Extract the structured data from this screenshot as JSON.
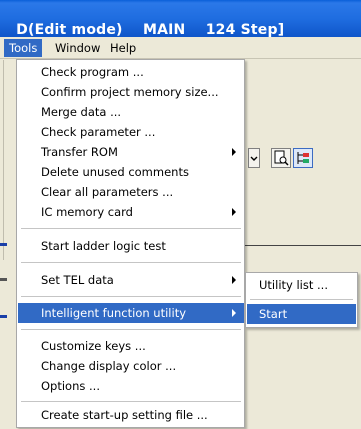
{
  "title": "D(Edit mode)    MAIN    124 Step]",
  "menubar": {
    "tools": "Tools",
    "window": "Window",
    "help": "Help"
  },
  "tools_menu": {
    "items": [
      {
        "label": "Check program ..."
      },
      {
        "label": "Confirm project memory size..."
      },
      {
        "label": "Merge data ..."
      },
      {
        "label": "Check parameter ..."
      },
      {
        "label": "Transfer ROM",
        "submenu": true
      },
      {
        "label": "Delete unused comments"
      },
      {
        "label": "Clear all parameters ..."
      },
      {
        "label": "IC memory card",
        "submenu": true
      },
      {
        "label": "Start ladder logic test"
      },
      {
        "label": "Set TEL data",
        "submenu": true
      },
      {
        "label": "Intelligent function utility",
        "submenu": true,
        "highlighted": true
      },
      {
        "label": "Customize keys ..."
      },
      {
        "label": "Change display color ..."
      },
      {
        "label": "Options ..."
      },
      {
        "label": "Create start-up setting file ..."
      }
    ]
  },
  "utility_submenu": {
    "items": [
      {
        "label": "Utility list ..."
      },
      {
        "label": "Start",
        "highlighted": true
      }
    ]
  },
  "colors": {
    "titlebar": "#1f6de0",
    "highlight": "#316ac5",
    "menu_bg": "#ece9d8"
  },
  "icons": [
    "submenu-arrow-icon",
    "print-preview-icon",
    "ladder-tree-icon",
    "dropdown-arrow-icon"
  ]
}
